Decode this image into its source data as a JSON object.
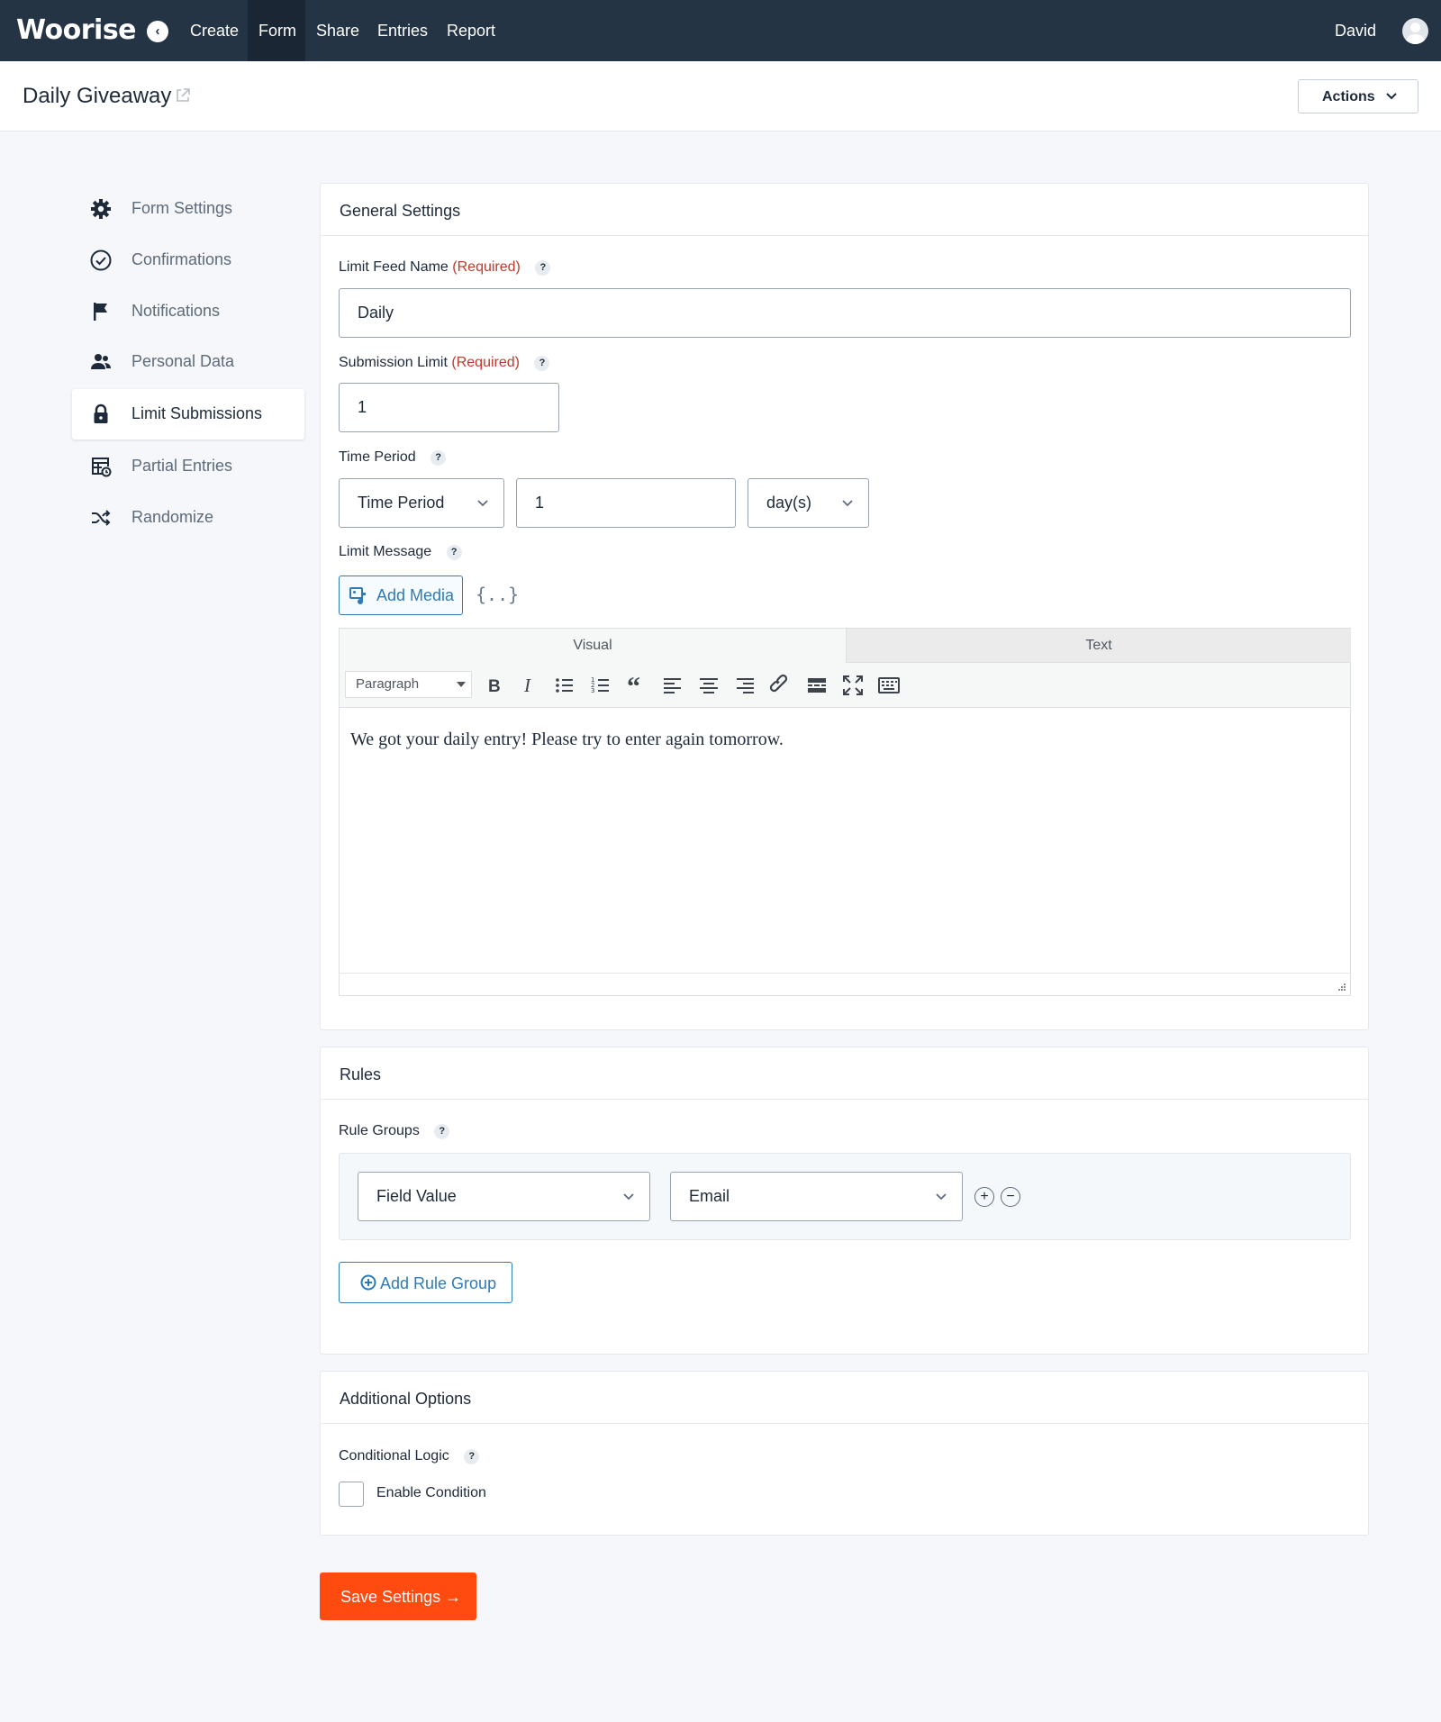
{
  "app": {
    "logo_text": "Woorise",
    "user_name": "David"
  },
  "nav": {
    "items": [
      "Create",
      "Form",
      "Share",
      "Entries",
      "Report"
    ],
    "active": "Form"
  },
  "page": {
    "title": "Daily Giveaway",
    "actions_label": "Actions"
  },
  "sidebar": {
    "items": [
      {
        "label": "Form Settings",
        "icon": "gear-icon"
      },
      {
        "label": "Confirmations",
        "icon": "check-circle-icon"
      },
      {
        "label": "Notifications",
        "icon": "flag-icon"
      },
      {
        "label": "Personal Data",
        "icon": "users-icon"
      },
      {
        "label": "Limit Submissions",
        "icon": "lock-icon"
      },
      {
        "label": "Partial Entries",
        "icon": "table-clock-icon"
      },
      {
        "label": "Randomize",
        "icon": "shuffle-icon"
      }
    ],
    "active": "Limit Submissions"
  },
  "general": {
    "title": "General Settings",
    "feed_name_label": "Limit Feed Name",
    "required_text": "(Required)",
    "feed_name_value": "Daily",
    "submission_limit_label": "Submission Limit",
    "submission_limit_value": "1",
    "time_period_label": "Time Period",
    "time_period_select": "Time Period",
    "time_period_value": "1",
    "time_period_unit": "day(s)",
    "limit_message_label": "Limit Message",
    "add_media_label": "Add Media",
    "merge_tag_symbol": "{..}",
    "editor_tab_visual": "Visual",
    "editor_tab_text": "Text",
    "paragraph_format": "Paragraph",
    "message_text": "We got your daily entry! Please try to enter again tomorrow."
  },
  "rules": {
    "title": "Rules",
    "rule_groups_label": "Rule Groups",
    "rule_type": "Field Value",
    "rule_field": "Email",
    "add_group_label": "Add Rule Group"
  },
  "additional": {
    "title": "Additional Options",
    "conditional_logic_label": "Conditional Logic",
    "enable_condition_label": "Enable Condition",
    "enable_condition_checked": false
  },
  "save": {
    "label": "Save Settings →"
  },
  "help_symbol": "?",
  "colors": {
    "topbar": "#253445",
    "accent": "#2e7bb8",
    "save": "#ff4b10",
    "required": "#c0392b"
  }
}
